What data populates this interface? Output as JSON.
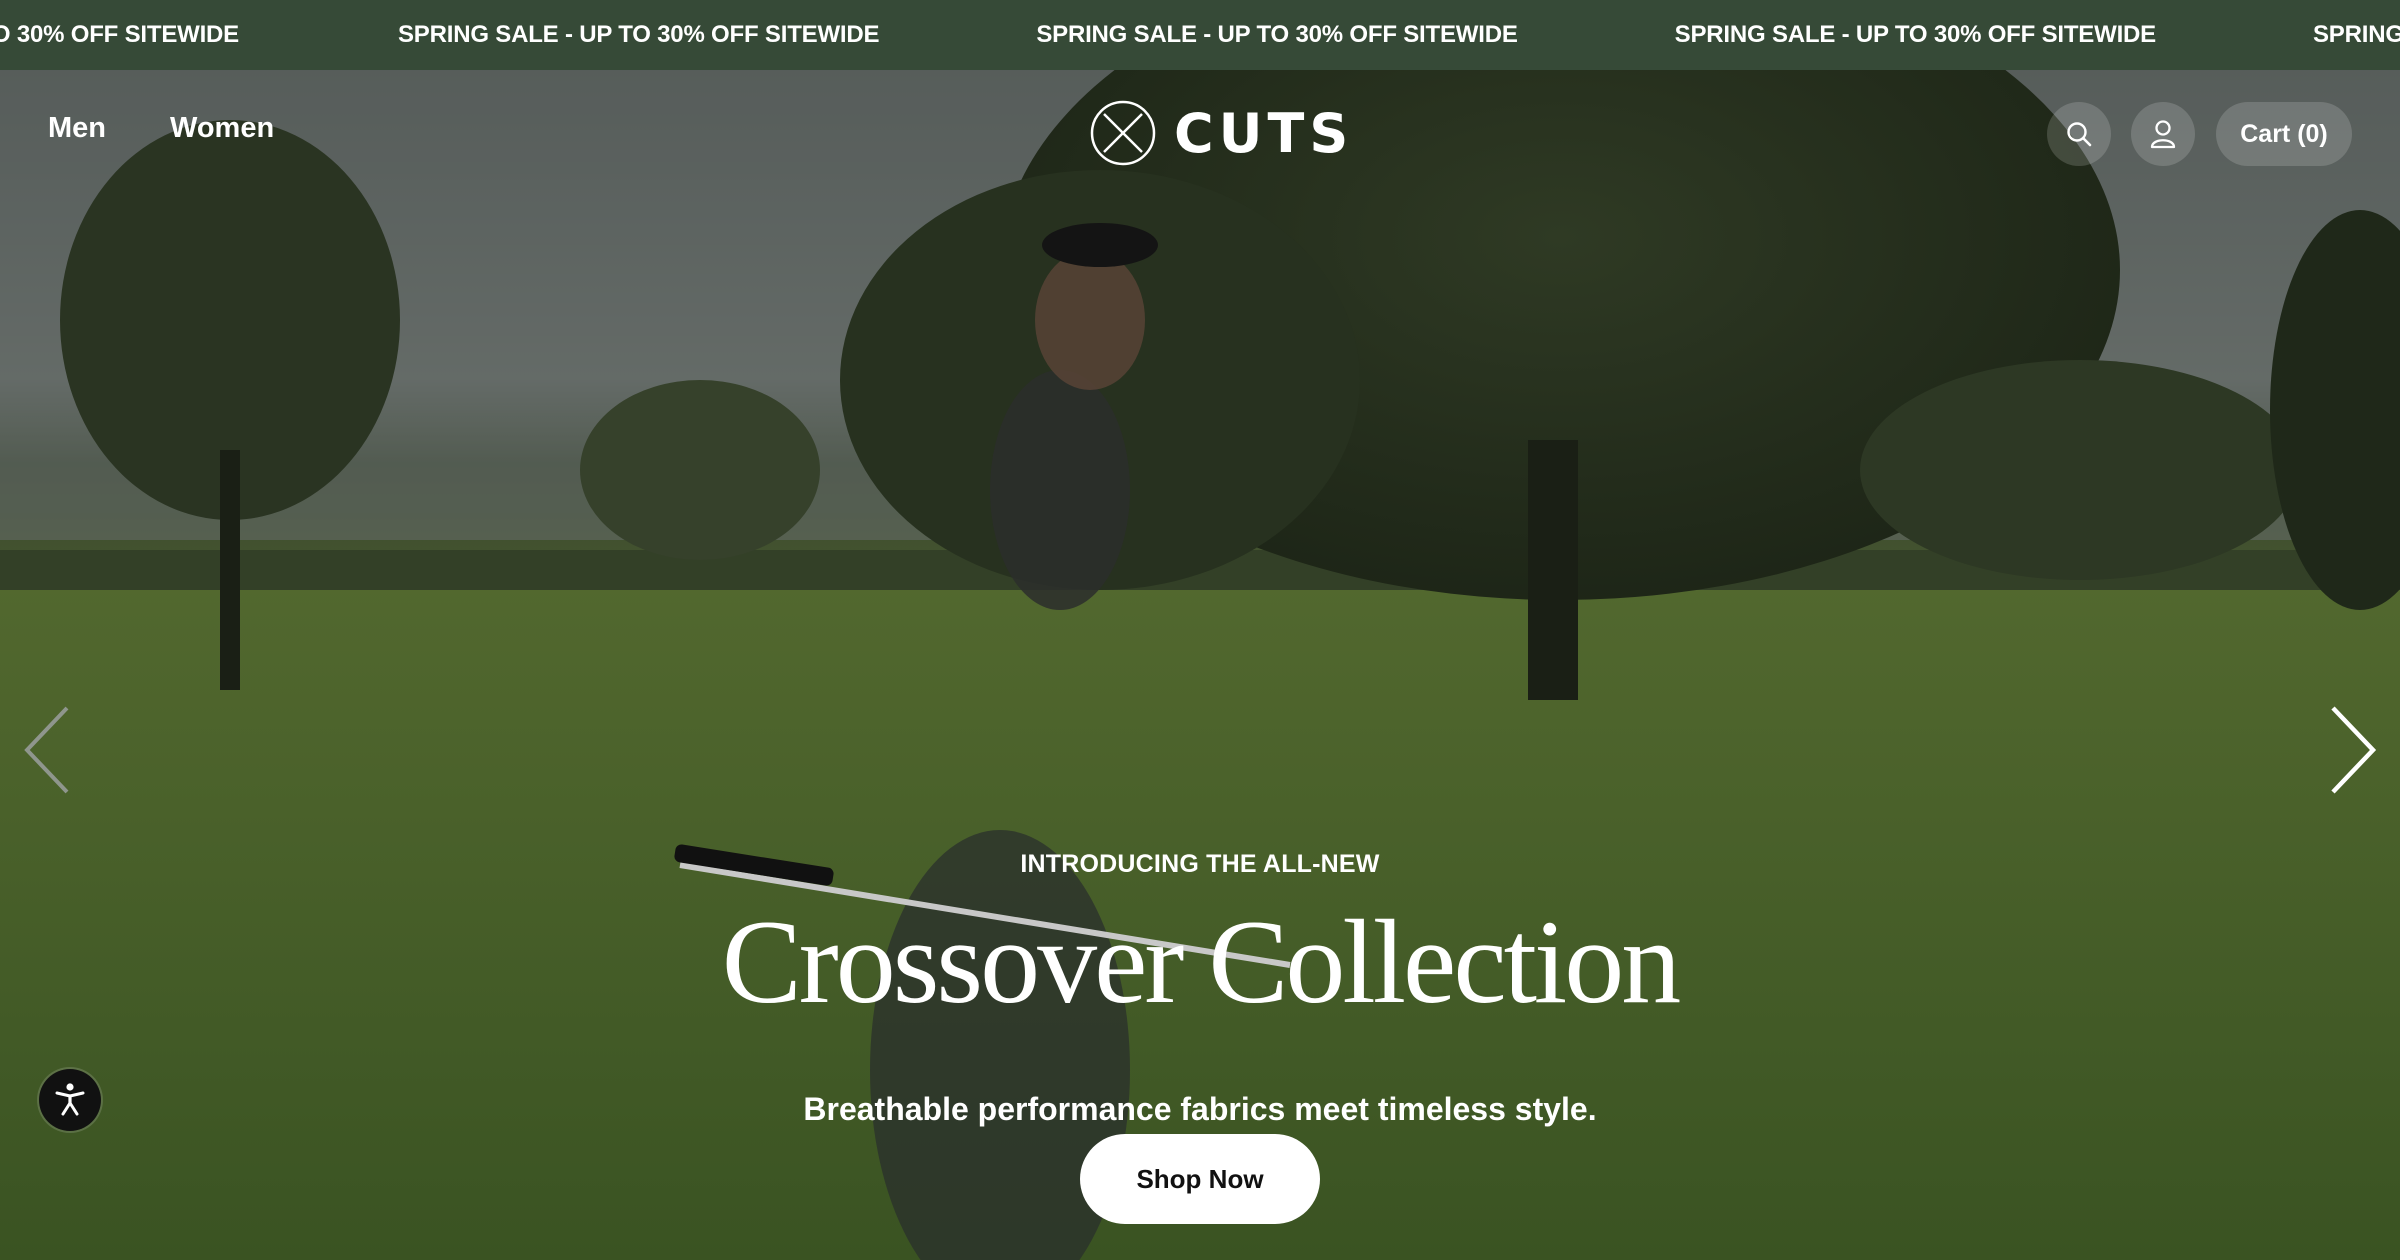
{
  "promo_bar": {
    "first_fragment": "SPRING SALE - UP TO 30% OFF SITEWIDE",
    "messages": [
      "SPRING SALE - UP TO 30% OFF SITEWIDE",
      "SPRING SALE - UP TO 30% OFF SITEWIDE",
      "SPRING SALE - UP TO 30% OFF SITEWIDE",
      "SPRING SALE - UP TO 30% OFF SITEWIDE"
    ],
    "background": "#364a37"
  },
  "header": {
    "nav": [
      "Men",
      "Women"
    ],
    "logo_text": "CUTS",
    "cart_label": "Cart (0)",
    "icons": [
      "search-icon",
      "account-icon"
    ]
  },
  "hero": {
    "eyebrow": "INTRODUCING THE ALL-NEW",
    "title": "Crossover Collection",
    "subtitle": "Breathable performance fabrics meet timeless style.",
    "cta_label": "Shop Now"
  },
  "carousel": {
    "icons": [
      "chevron-left-icon",
      "chevron-right-icon"
    ]
  },
  "accessibility": {
    "icon": "accessibility-icon"
  }
}
